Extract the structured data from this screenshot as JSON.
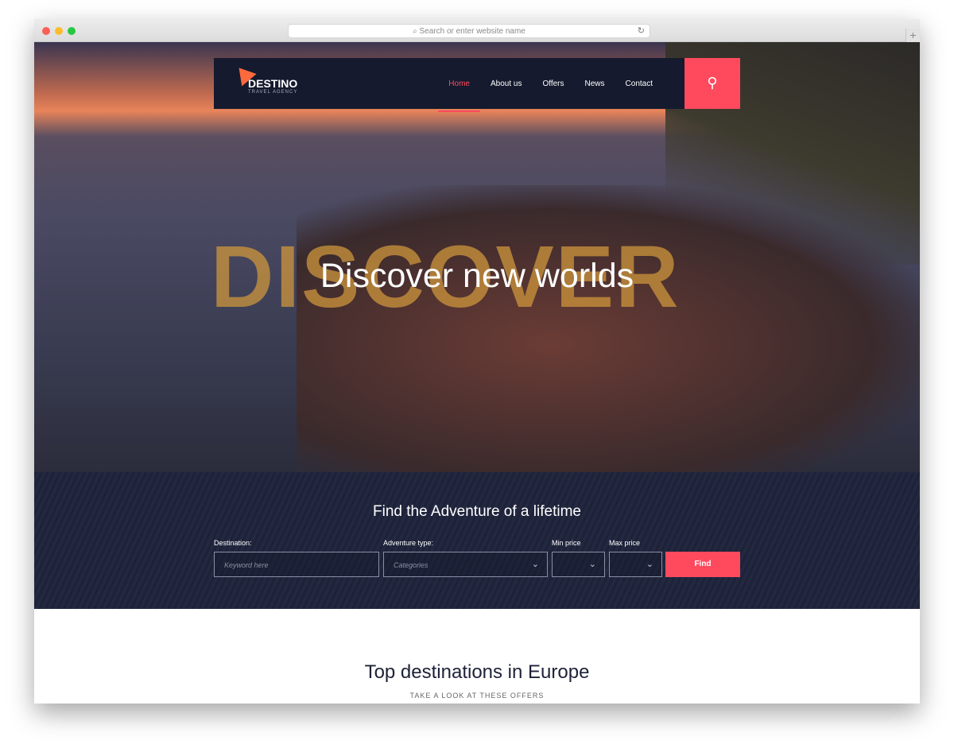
{
  "browser": {
    "url_placeholder": "Search or enter website name"
  },
  "nav": {
    "logo": "DESTINO",
    "logo_sub": "TRAVEL AGENCY",
    "items": [
      "Home",
      "About us",
      "Offers",
      "News",
      "Contact"
    ],
    "active": "Home"
  },
  "hero": {
    "background_word": "DISCOVER",
    "headline": "Discover new worlds"
  },
  "search": {
    "title": "Find the Adventure of a lifetime",
    "destination_label": "Destination:",
    "destination_placeholder": "Keyword here",
    "type_label": "Adventure type:",
    "type_placeholder": "Categories",
    "min_label": "Min price",
    "max_label": "Max price",
    "find": "Find"
  },
  "section": {
    "title": "Top destinations in Europe",
    "subtitle": "TAKE A LOOK AT THESE OFFERS"
  },
  "colors": {
    "accent": "#ff4a5e",
    "navy": "#151a2e"
  }
}
